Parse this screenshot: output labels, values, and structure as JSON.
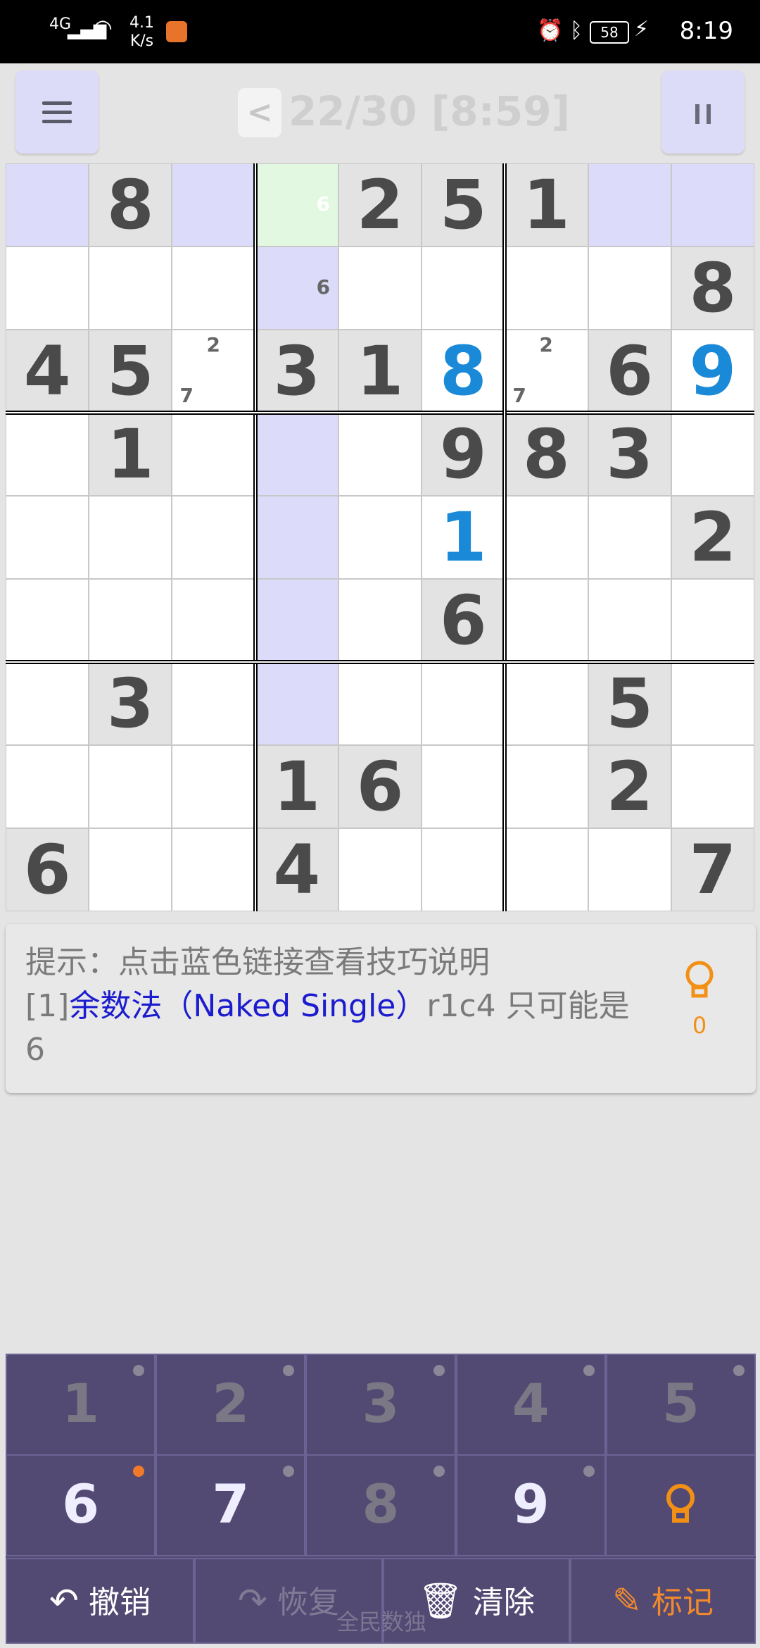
{
  "status_bar": {
    "network": "4G",
    "speed_value": "4.1",
    "speed_unit": "K/s",
    "battery": "58",
    "time": "8:19",
    "icons": [
      "wifi-icon",
      "alarm-icon",
      "bluetooth-icon",
      "battery-icon"
    ]
  },
  "header": {
    "title": "22/30 [8:59]",
    "back_label": "<",
    "menu_icon": "menu-icon",
    "pause_icon": "pause-icon"
  },
  "board": {
    "rows": [
      [
        "",
        "8",
        "",
        "",
        "2",
        "5",
        "1",
        "",
        ""
      ],
      [
        "",
        "",
        "",
        "",
        "",
        "",
        "",
        "",
        "8"
      ],
      [
        "4",
        "5",
        "",
        "3",
        "1",
        "8",
        "",
        "6",
        "9"
      ],
      [
        "",
        "1",
        "",
        "",
        "",
        "9",
        "8",
        "3",
        ""
      ],
      [
        "",
        "",
        "",
        "",
        "",
        "1",
        "",
        "",
        "2"
      ],
      [
        "",
        "",
        "",
        "",
        "",
        "6",
        "",
        "",
        ""
      ],
      [
        "",
        "3",
        "",
        "",
        "",
        "",
        "",
        "5",
        ""
      ],
      [
        "",
        "",
        "",
        "1",
        "6",
        "",
        "",
        "2",
        ""
      ],
      [
        "6",
        "",
        "",
        "4",
        "",
        "",
        "",
        "",
        "7"
      ]
    ],
    "user_filled": [
      [
        2,
        5
      ],
      [
        2,
        8
      ],
      [
        4,
        5
      ]
    ],
    "notes": [
      {
        "row": 0,
        "col": 3,
        "text": "6"
      },
      {
        "row": 1,
        "col": 3,
        "text": "6"
      },
      {
        "row": 2,
        "col": 2,
        "text": "2"
      },
      {
        "row": 2,
        "col": 2,
        "text": "7"
      },
      {
        "row": 2,
        "col": 6,
        "text": "2"
      },
      {
        "row": 2,
        "col": 6,
        "text": "7"
      }
    ],
    "selected": [
      0,
      3
    ],
    "colors": {
      "highlight": "#dcdcfa",
      "selected": "#e2f8e0",
      "given": "#e3e3e3",
      "user_digit": "#1a8ad8"
    }
  },
  "hint": {
    "line1": "提示：点击蓝色链接查看技巧说明",
    "index": "[1]",
    "link": "余数法（Naked Single）",
    "rest": "r1c4 只可能是",
    "value": "6",
    "bulb_icon": "lightbulb-icon",
    "bulb_count": "0"
  },
  "keypad": {
    "keys": [
      {
        "label": "1",
        "active": false,
        "dot": "grey"
      },
      {
        "label": "2",
        "active": false,
        "dot": "grey"
      },
      {
        "label": "3",
        "active": false,
        "dot": "grey"
      },
      {
        "label": "4",
        "active": false,
        "dot": "grey"
      },
      {
        "label": "5",
        "active": false,
        "dot": "grey"
      },
      {
        "label": "6",
        "active": true,
        "dot": "orange"
      },
      {
        "label": "7",
        "active": true,
        "dot": "grey"
      },
      {
        "label": "8",
        "active": false,
        "dot": "grey"
      },
      {
        "label": "9",
        "active": true,
        "dot": "grey"
      }
    ],
    "hint_key_icon": "lightbulb-icon",
    "actions": {
      "undo": "撤销",
      "redo": "恢复",
      "clear": "清除",
      "mark": "标记"
    },
    "watermark": "全民数独"
  }
}
